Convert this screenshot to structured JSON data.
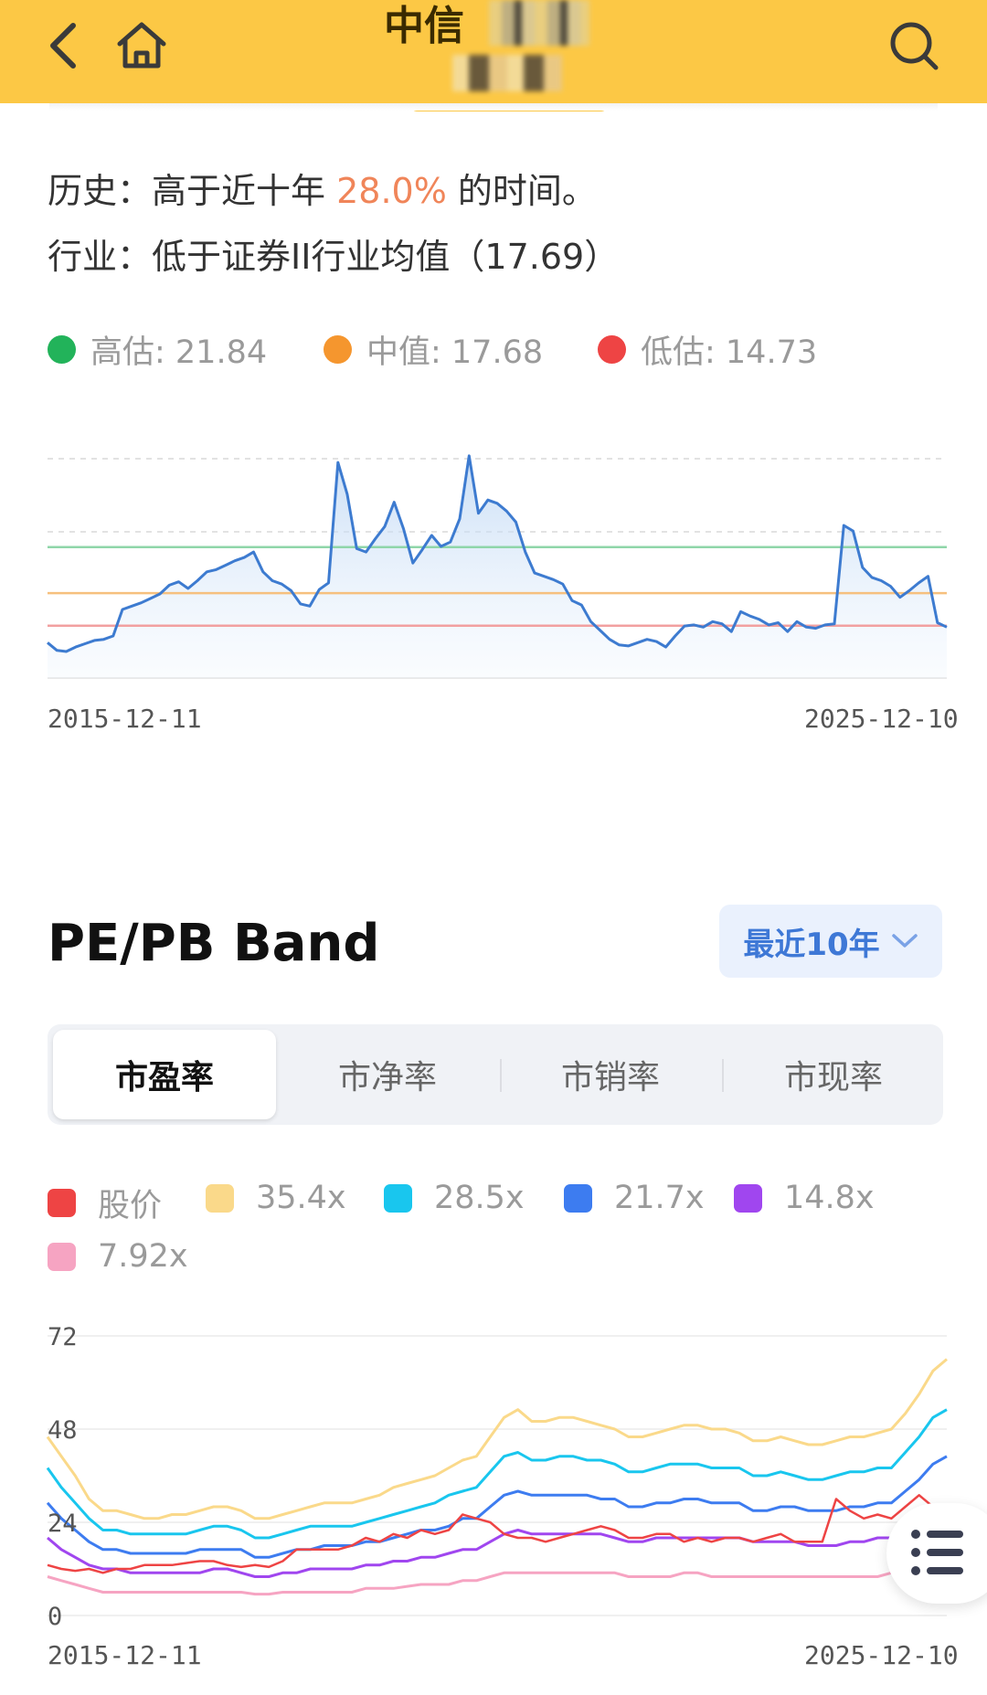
{
  "header": {
    "title": "中信",
    "back_icon": "back-chevron-icon",
    "home_icon": "home-icon",
    "search_icon": "search-icon",
    "bg_color": "#fcc845"
  },
  "summary": {
    "history_prefix": "历史：高于近十年 ",
    "history_value": "28.0%",
    "history_suffix": " 的时间。",
    "industry": "行业：低于证券II行业均值（17.69）",
    "accent_color": "#f08559"
  },
  "pe_legend": [
    {
      "label": "高估: 21.84",
      "color": "#22b35a"
    },
    {
      "label": "中值: 17.68",
      "color": "#f5962e"
    },
    {
      "label": "低估: 14.73",
      "color": "#ee4444"
    }
  ],
  "pe_chart": {
    "type": "line",
    "x_start": "2015-12-11",
    "x_end": "2025-12-10",
    "high": 21.84,
    "median": 17.68,
    "low": 14.73,
    "series": [
      {
        "values": [
          13.2,
          12.5,
          12.4,
          12.8,
          13.1,
          13.4,
          13.5,
          13.8,
          16.2,
          16.5,
          16.8,
          17.2,
          17.6,
          18.4,
          18.7,
          18.1,
          18.8,
          19.6,
          19.8,
          20.2,
          20.6,
          20.9,
          21.4,
          19.6,
          18.8,
          18.5,
          17.9,
          16.7,
          16.5,
          18.0,
          18.6,
          29.5,
          26.6,
          21.7,
          21.4,
          22.6,
          23.7,
          25.9,
          23.5,
          20.4,
          21.6,
          22.9,
          21.9,
          22.3,
          24.4,
          30.1,
          24.9,
          26.1,
          25.8,
          25.1,
          24.1,
          21.4,
          19.5,
          19.2,
          18.9,
          18.5,
          17.0,
          16.6,
          15.1,
          14.3,
          13.5,
          13.0,
          12.9,
          13.2,
          13.5,
          13.3,
          12.8,
          13.8,
          14.7,
          14.8,
          14.6,
          15.1,
          14.9,
          14.2,
          16.0,
          15.6,
          15.3,
          14.8,
          15.0,
          14.2,
          15.1,
          14.6,
          14.5,
          14.8,
          14.9,
          23.8,
          23.3,
          20.0,
          19.1,
          18.8,
          18.3,
          17.3,
          17.9,
          18.6,
          19.2,
          15.0,
          14.6
        ]
      }
    ],
    "ylim": [
      10,
      30
    ]
  },
  "band": {
    "section_title": "PE/PB Band",
    "period_label": "最近10年",
    "tabs": [
      "市盈率",
      "市净率",
      "市销率",
      "市现率"
    ],
    "active_tab": 0,
    "legend": [
      {
        "label": "股价",
        "color": "#ee4444"
      },
      {
        "label": "35.4x",
        "color": "#fad98a"
      },
      {
        "label": "28.5x",
        "color": "#19c6ee"
      },
      {
        "label": "21.7x",
        "color": "#3d7cf0"
      },
      {
        "label": "14.8x",
        "color": "#a046ef"
      },
      {
        "label": "7.92x",
        "color": "#f6a4c2"
      }
    ],
    "y_ticks": [
      "72",
      "48",
      "24",
      "0"
    ]
  },
  "chart_data": {
    "type": "line",
    "x_start": "2015-12-11",
    "x_end": "2025-12-10",
    "ylim": [
      0,
      72
    ],
    "series": [
      {
        "name": "股价",
        "values": [
          13,
          12,
          11.5,
          12,
          11,
          12,
          12,
          13,
          13,
          13,
          13.5,
          14,
          14,
          13,
          12.5,
          13,
          12.5,
          14,
          17,
          17,
          17,
          17,
          18,
          20,
          19,
          21,
          20,
          22,
          21,
          22,
          26,
          25,
          24,
          21,
          20,
          20,
          19,
          20,
          21,
          22,
          23,
          22,
          20,
          20,
          21,
          21,
          19,
          20,
          19,
          20,
          20,
          19,
          20,
          21,
          19,
          19,
          19,
          30,
          27,
          25,
          26,
          25,
          28,
          31,
          28,
          27
        ]
      },
      {
        "name": "35.4x",
        "values": [
          46,
          41,
          36,
          30,
          27,
          27,
          26,
          25,
          25,
          26,
          26,
          27,
          28,
          28,
          27,
          25,
          25,
          26,
          27,
          28,
          29,
          29,
          29,
          30,
          31,
          33,
          34,
          35,
          36,
          38,
          40,
          41,
          46,
          51,
          53,
          50,
          50,
          51,
          51,
          50,
          49,
          48,
          46,
          46,
          47,
          48,
          49,
          49,
          48,
          48,
          47,
          45,
          45,
          46,
          45,
          44,
          44,
          45,
          46,
          46,
          47,
          48,
          52,
          57,
          63,
          66
        ]
      },
      {
        "name": "28.5x",
        "values": [
          38,
          33,
          29,
          25,
          22,
          22,
          21,
          21,
          21,
          21,
          21,
          22,
          23,
          23,
          22,
          20,
          20,
          21,
          22,
          23,
          23,
          23,
          23,
          24,
          25,
          26,
          27,
          28,
          29,
          31,
          32,
          33,
          37,
          41,
          42,
          40,
          40,
          41,
          41,
          40,
          40,
          39,
          37,
          37,
          38,
          39,
          39,
          39,
          38,
          38,
          38,
          36,
          36,
          37,
          36,
          35,
          35,
          36,
          37,
          37,
          38,
          38,
          42,
          46,
          51,
          53
        ]
      },
      {
        "name": "21.7x",
        "values": [
          29,
          25,
          22,
          19,
          17,
          17,
          16,
          16,
          16,
          16,
          16,
          17,
          17,
          17,
          17,
          15,
          15,
          16,
          17,
          17,
          18,
          18,
          18,
          19,
          19,
          20,
          21,
          22,
          22,
          23,
          25,
          25,
          28,
          31,
          32,
          31,
          31,
          31,
          31,
          31,
          30,
          30,
          28,
          28,
          29,
          29,
          30,
          30,
          29,
          29,
          29,
          27,
          27,
          28,
          28,
          27,
          27,
          27,
          28,
          28,
          29,
          29,
          32,
          35,
          39,
          41
        ]
      },
      {
        "name": "14.8x",
        "values": [
          20,
          17,
          15,
          13,
          12,
          12,
          11,
          11,
          11,
          11,
          11,
          11,
          12,
          12,
          11,
          10,
          10,
          11,
          11,
          12,
          12,
          12,
          12,
          13,
          13,
          14,
          14,
          15,
          15,
          16,
          17,
          17,
          19,
          21,
          22,
          21,
          21,
          21,
          21,
          21,
          21,
          20,
          19,
          19,
          20,
          20,
          20,
          20,
          20,
          20,
          20,
          19,
          19,
          19,
          19,
          18,
          18,
          18,
          19,
          19,
          20,
          20,
          22,
          24,
          26,
          28
        ]
      },
      {
        "name": "7.92x",
        "values": [
          10,
          9,
          8,
          7,
          6,
          6,
          6,
          6,
          6,
          6,
          6,
          6,
          6,
          6,
          6,
          5.5,
          5.5,
          6,
          6,
          6,
          6,
          6,
          6,
          7,
          7,
          7,
          7.5,
          8,
          8,
          8,
          9,
          9,
          10,
          11,
          11,
          11,
          11,
          11,
          11,
          11,
          11,
          11,
          10,
          10,
          10,
          10,
          11,
          11,
          10,
          10,
          10,
          10,
          10,
          10,
          10,
          10,
          10,
          10,
          10,
          10,
          10,
          11,
          12,
          13,
          14,
          15
        ]
      }
    ]
  }
}
